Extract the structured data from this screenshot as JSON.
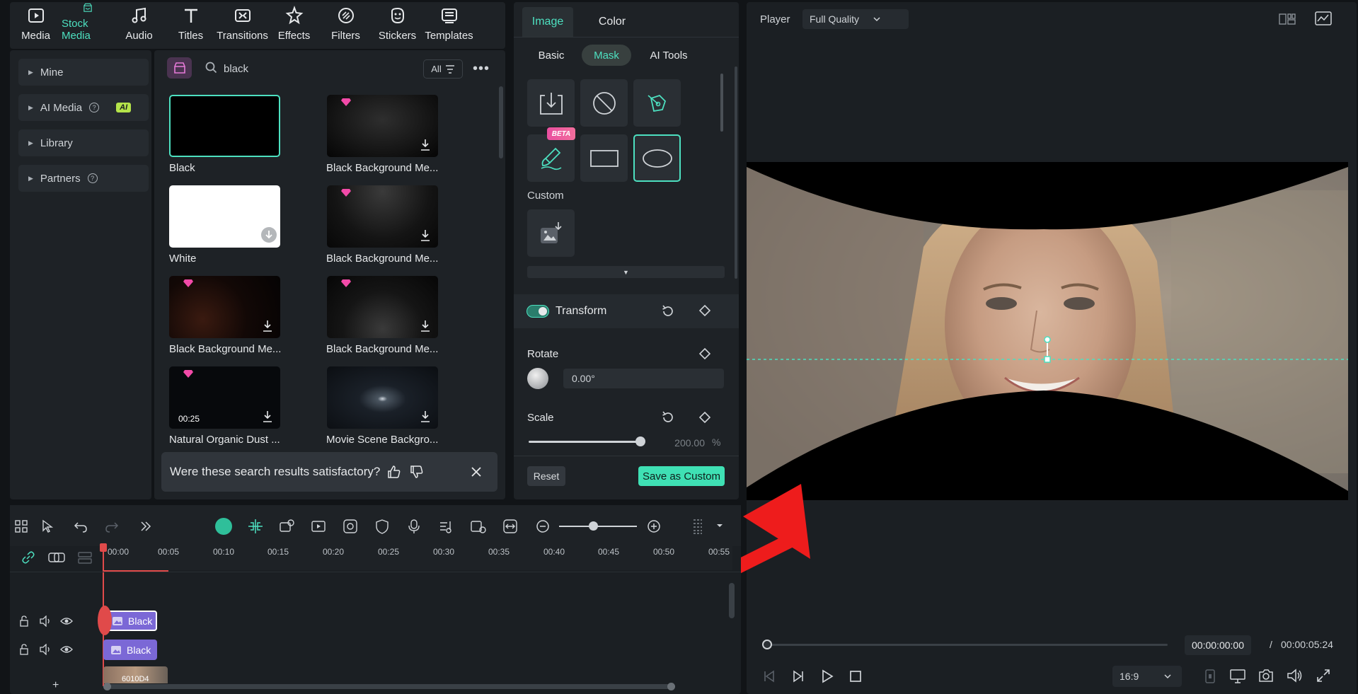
{
  "nav": {
    "items": [
      {
        "label": "Media",
        "icon": "media-icon"
      },
      {
        "label": "Stock Media",
        "icon": "stock-media-icon",
        "active": true
      },
      {
        "label": "Audio",
        "icon": "audio-icon"
      },
      {
        "label": "Titles",
        "icon": "titles-icon"
      },
      {
        "label": "Transitions",
        "icon": "transitions-icon"
      },
      {
        "label": "Effects",
        "icon": "effects-icon"
      },
      {
        "label": "Filters",
        "icon": "filters-icon"
      },
      {
        "label": "Stickers",
        "icon": "stickers-icon"
      },
      {
        "label": "Templates",
        "icon": "templates-icon"
      }
    ]
  },
  "library": {
    "mine": "Mine",
    "ai_media": "AI Media",
    "ai_badge": "AI",
    "library": "Library",
    "partners": "Partners"
  },
  "search": {
    "query": "black",
    "filter_label": "All"
  },
  "results": [
    {
      "label": "Black"
    },
    {
      "label": "Black Background Me..."
    },
    {
      "label": "White"
    },
    {
      "label": "Black Background Me..."
    },
    {
      "label": "Black Background Me..."
    },
    {
      "label": "Black Background Me..."
    },
    {
      "label": "Natural Organic Dust ...",
      "duration": "00:25"
    },
    {
      "label": "Movie Scene Backgro..."
    }
  ],
  "feedback": {
    "question": "Were these search results satisfactory?"
  },
  "props": {
    "tab_image": "Image",
    "tab_color": "Color",
    "sub_basic": "Basic",
    "sub_mask": "Mask",
    "sub_ai": "AI Tools",
    "beta": "BETA",
    "custom": "Custom",
    "transform": "Transform",
    "rotate": "Rotate",
    "rotate_value": "0.00°",
    "scale": "Scale",
    "scale_value": "200.00",
    "scale_unit": "%",
    "reset": "Reset",
    "save_custom": "Save as Custom"
  },
  "player": {
    "label": "Player",
    "quality": "Full Quality",
    "current_time": "00:00:00:00",
    "separator": "/",
    "total_time": "00:00:05:24",
    "aspect": "16:9"
  },
  "timeline": {
    "ticks": [
      "00:00",
      "00:05",
      "00:10",
      "00:15",
      "00:20",
      "00:25",
      "00:30",
      "00:35",
      "00:40",
      "00:45",
      "00:50",
      "00:55"
    ],
    "clip1": "Black",
    "clip2": "Black",
    "clip3": "6010D4",
    "add": "+"
  },
  "colors": {
    "accent": "#4de0c0",
    "clip": "#7b68d6",
    "arrow": "#ee1c1c"
  }
}
